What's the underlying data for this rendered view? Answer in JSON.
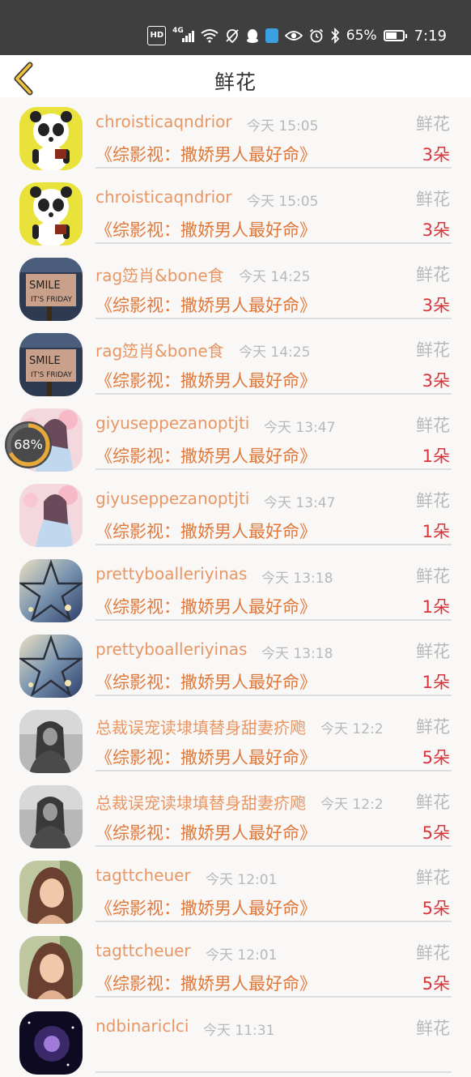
{
  "status_bar": {
    "network_badge": "HD",
    "network_type": "4G",
    "battery_percent": "65%",
    "battery_level": 0.65,
    "time": "7:19"
  },
  "header": {
    "title": "鲜花",
    "back_icon": "chevron-left-icon"
  },
  "floating_progress": {
    "label": "68%",
    "value": 0.68
  },
  "records": [
    {
      "user": "chroisticaqndrior",
      "time": "今天 15:05",
      "gift": "鲜花",
      "book": "《综影视：撒娇男人最好命》",
      "count": "3朵",
      "avatar": "panda"
    },
    {
      "user": "chroisticaqndrior",
      "time": "今天 15:05",
      "gift": "鲜花",
      "book": "《综影视：撒娇男人最好命》",
      "count": "3朵",
      "avatar": "panda"
    },
    {
      "user": "rag笾肖&bone食",
      "time": "今天 14:25",
      "gift": "鲜花",
      "book": "《综影视：撒娇男人最好命》",
      "count": "3朵",
      "avatar": "smile"
    },
    {
      "user": "rag笾肖&bone食",
      "time": "今天 14:25",
      "gift": "鲜花",
      "book": "《综影视：撒娇男人最好命》",
      "count": "3朵",
      "avatar": "smile"
    },
    {
      "user": "giyuseppezanoptjti",
      "time": "今天 13:47",
      "gift": "鲜花",
      "book": "《综影视：撒娇男人最好命》",
      "count": "1朵",
      "avatar": "anime"
    },
    {
      "user": "giyuseppezanoptjti",
      "time": "今天 13:47",
      "gift": "鲜花",
      "book": "《综影视：撒娇男人最好命》",
      "count": "1朵",
      "avatar": "anime"
    },
    {
      "user": "prettyboalleriyinas",
      "time": "今天 13:18",
      "gift": "鲜花",
      "book": "《综影视：撒娇男人最好命》",
      "count": "1朵",
      "avatar": "star"
    },
    {
      "user": "prettyboalleriyinas",
      "time": "今天 13:18",
      "gift": "鲜花",
      "book": "《综影视：撒娇男人最好命》",
      "count": "1朵",
      "avatar": "star"
    },
    {
      "user": "总裁误宠读埭填替身甜妻疥飑",
      "time": "今天 12:2",
      "gift": "鲜花",
      "book": "《综影视：撒娇男人最好命》",
      "count": "5朵",
      "avatar": "bw"
    },
    {
      "user": "总裁误宠读埭填替身甜妻疥飑",
      "time": "今天 12:2",
      "gift": "鲜花",
      "book": "《综影视：撒娇男人最好命》",
      "count": "5朵",
      "avatar": "bw"
    },
    {
      "user": "tagttcheuer",
      "time": "今天 12:01",
      "gift": "鲜花",
      "book": "《综影视：撒娇男人最好命》",
      "count": "5朵",
      "avatar": "girl"
    },
    {
      "user": "tagttcheuer",
      "time": "今天 12:01",
      "gift": "鲜花",
      "book": "《综影视：撒娇男人最好命》",
      "count": "5朵",
      "avatar": "girl"
    },
    {
      "user": "ndbinariclci",
      "time": "今天 11:31",
      "gift": "鲜花",
      "book": "",
      "count": "",
      "avatar": "space"
    }
  ]
}
